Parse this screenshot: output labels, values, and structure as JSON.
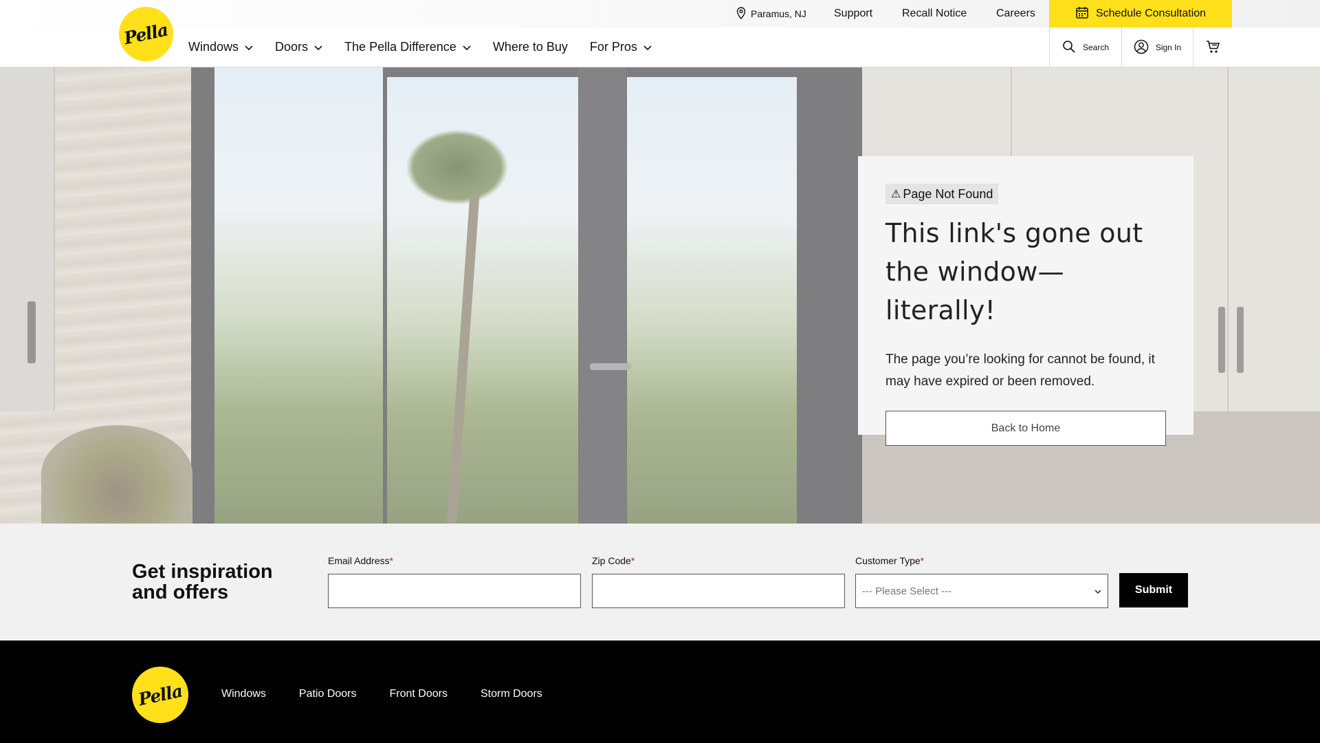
{
  "brand": {
    "logo_text": "Pella",
    "accent": "#ffe01b"
  },
  "utility": {
    "location": "Paramus, NJ",
    "support": "Support",
    "recall": "Recall Notice",
    "careers": "Careers",
    "schedule": "Schedule Consultation"
  },
  "nav": {
    "items": [
      {
        "label": "Windows"
      },
      {
        "label": "Doors"
      },
      {
        "label": "The Pella Difference"
      },
      {
        "label": "Where to Buy"
      },
      {
        "label": "For Pros"
      }
    ]
  },
  "tools": {
    "search": "Search",
    "signin": "Sign In"
  },
  "error_card": {
    "badge": "Page Not Found",
    "title": "This link's gone out the window—literally!",
    "text": "The page you’re looking for cannot be found, it may have expired or been removed.",
    "button": "Back to Home"
  },
  "signup": {
    "title": "Get inspiration and offers",
    "email_label": "Email Address",
    "zip_label": "Zip Code",
    "customer_label": "Customer Type",
    "customer_placeholder": "--- Please Select ---",
    "required_mark": "*",
    "submit": "Submit"
  },
  "footer": {
    "links": [
      {
        "label": "Windows"
      },
      {
        "label": "Patio Doors"
      },
      {
        "label": "Front Doors"
      },
      {
        "label": "Storm Doors"
      }
    ]
  }
}
